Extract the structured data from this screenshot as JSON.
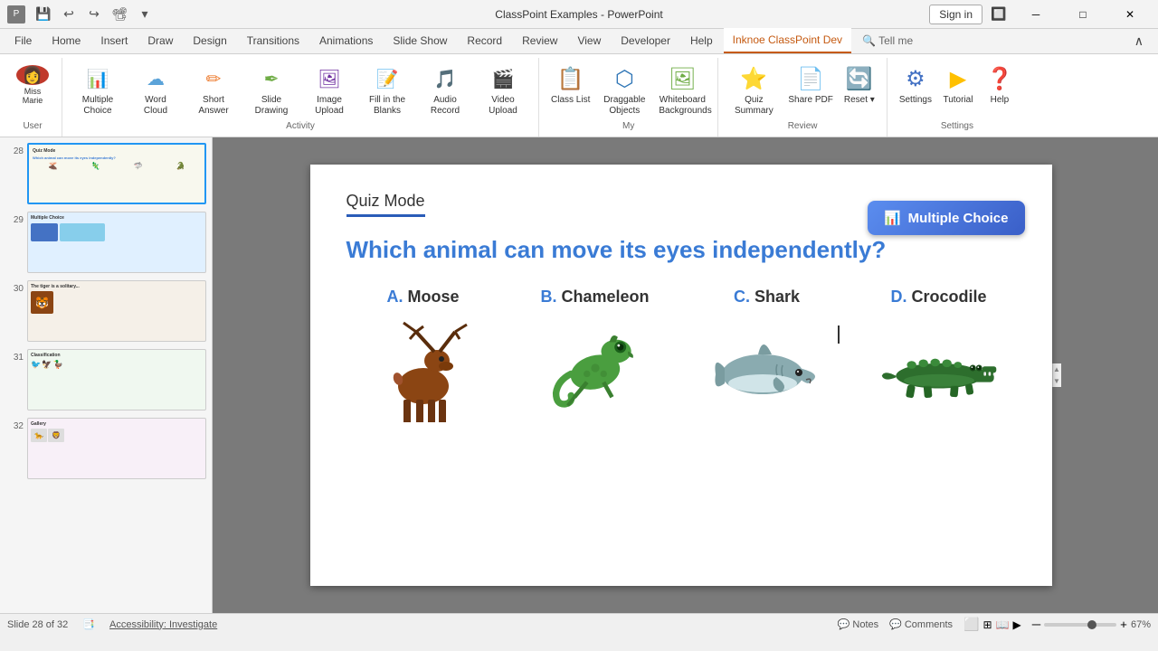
{
  "titlebar": {
    "title": "ClassPoint Examples - PowerPoint",
    "sign_in": "Sign in"
  },
  "qat": {
    "save": "💾",
    "undo": "↩",
    "redo": "↪",
    "present": "📊"
  },
  "tabs": [
    {
      "label": "File",
      "active": false
    },
    {
      "label": "Home",
      "active": false
    },
    {
      "label": "Insert",
      "active": false
    },
    {
      "label": "Draw",
      "active": false
    },
    {
      "label": "Design",
      "active": false
    },
    {
      "label": "Transitions",
      "active": false
    },
    {
      "label": "Animations",
      "active": false
    },
    {
      "label": "Slide Show",
      "active": false
    },
    {
      "label": "Record",
      "active": false
    },
    {
      "label": "Review",
      "active": false
    },
    {
      "label": "View",
      "active": false
    },
    {
      "label": "Developer",
      "active": false
    },
    {
      "label": "Help",
      "active": false
    },
    {
      "label": "Inknoe ClassPoint Dev",
      "active": true
    },
    {
      "label": "Tell me",
      "active": false
    }
  ],
  "ribbon": {
    "user": {
      "name": "Miss Marie",
      "avatar": "👩"
    },
    "activity_group": {
      "label": "Activity",
      "items": [
        {
          "id": "multiple-choice",
          "label": "Multiple Choice",
          "icon": "📊"
        },
        {
          "id": "word-cloud",
          "label": "Word Cloud",
          "icon": "☁"
        },
        {
          "id": "short-answer",
          "label": "Short Answer",
          "icon": "✏"
        },
        {
          "id": "slide-drawing",
          "label": "Slide Drawing",
          "icon": "🖊"
        },
        {
          "id": "image-upload",
          "label": "Image Upload",
          "icon": "🖼"
        },
        {
          "id": "fill-blanks",
          "label": "Fill in the Blanks",
          "icon": "📝"
        },
        {
          "id": "audio-record",
          "label": "Audio Record",
          "icon": "🎵"
        },
        {
          "id": "video-upload",
          "label": "Video Upload",
          "icon": "🎬"
        }
      ]
    },
    "my_group": {
      "label": "My",
      "items": [
        {
          "id": "class-list",
          "label": "Class List",
          "icon": "📋"
        },
        {
          "id": "draggable-objects",
          "label": "Draggable Objects",
          "icon": "🔲"
        },
        {
          "id": "whiteboard-bg",
          "label": "Whiteboard Backgrounds",
          "icon": "🖼"
        }
      ]
    },
    "review_group": {
      "label": "Review",
      "items": [
        {
          "id": "quiz-summary",
          "label": "Quiz Summary",
          "icon": "⭐"
        },
        {
          "id": "share-pdf",
          "label": "Share PDF",
          "icon": "📄"
        },
        {
          "id": "reset",
          "label": "Reset",
          "icon": "🔄"
        }
      ]
    },
    "settings_group": {
      "label": "Settings",
      "items": [
        {
          "id": "settings",
          "label": "Settings",
          "icon": "⚙"
        },
        {
          "id": "tutorial",
          "label": "Tutorial",
          "icon": "▶"
        },
        {
          "id": "help",
          "label": "Help",
          "icon": "❓"
        }
      ]
    }
  },
  "slides": [
    {
      "num": 28,
      "active": true
    },
    {
      "num": 29,
      "active": false
    },
    {
      "num": 30,
      "active": false
    },
    {
      "num": 31,
      "active": false
    },
    {
      "num": 32,
      "active": false
    }
  ],
  "slide": {
    "quiz_mode_label": "Quiz Mode",
    "question": "Which animal can move its eyes independently?",
    "multiple_choice_btn": "Multiple Choice",
    "answers": [
      {
        "letter": "A.",
        "label": "Moose",
        "emoji": "🫎"
      },
      {
        "letter": "B.",
        "label": "Chameleon",
        "emoji": "🦎"
      },
      {
        "letter": "C.",
        "label": "Shark",
        "emoji": "🦈"
      },
      {
        "letter": "D.",
        "label": "Crocodile",
        "emoji": "🐊"
      }
    ]
  },
  "status": {
    "slide_info": "Slide 28 of 32",
    "accessibility": "Accessibility: Investigate",
    "notes": "Notes",
    "comments": "Comments",
    "zoom": "67%"
  },
  "collapse_icon": "∧"
}
